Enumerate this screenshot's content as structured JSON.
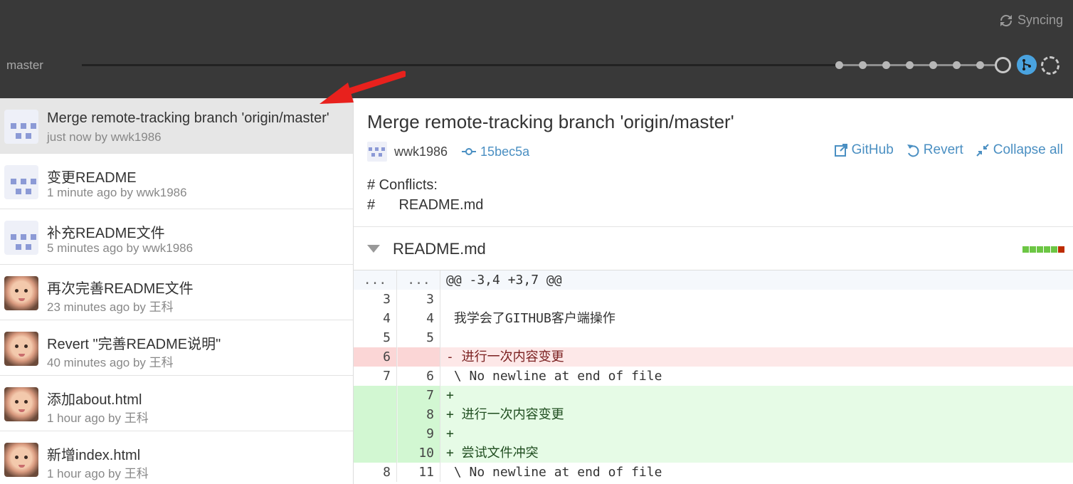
{
  "topbar": {
    "sync_label": "Syncing",
    "branch": "master"
  },
  "commits": [
    {
      "title": "Merge remote-tracking branch 'origin/master'",
      "meta": "just now by wwk1986",
      "avatar": "identicon"
    },
    {
      "title": "变更README",
      "meta": "1 minute ago by wwk1986",
      "avatar": "identicon"
    },
    {
      "title": "补充README文件",
      "meta": "5 minutes ago by wwk1986",
      "avatar": "identicon"
    },
    {
      "title": "再次完善README文件",
      "meta": "23 minutes ago by 王科",
      "avatar": "photo"
    },
    {
      "title": "Revert \"完善README说明\"",
      "meta": "40 minutes ago by 王科",
      "avatar": "photo"
    },
    {
      "title": "添加about.html",
      "meta": "1 hour ago by 王科",
      "avatar": "photo"
    },
    {
      "title": "新增index.html",
      "meta": "1 hour ago by 王科",
      "avatar": "photo"
    }
  ],
  "detail": {
    "title": "Merge remote-tracking branch 'origin/master'",
    "author": "wwk1986",
    "sha": "15bec5a",
    "actions": {
      "github": "GitHub",
      "revert": "Revert",
      "collapse": "Collapse all"
    },
    "body": "# Conflicts:\n#\tREADME.md",
    "file": {
      "name": "README.md",
      "stat_colors": [
        "#6cc644",
        "#6cc644",
        "#6cc644",
        "#6cc644",
        "#6cc644",
        "#bd2c00"
      ]
    },
    "diff": [
      {
        "type": "hunk",
        "old": "...",
        "new": "...",
        "text": "@@ -3,4 +3,7 @@"
      },
      {
        "type": "ctx",
        "old": "3",
        "new": "3",
        "text": " "
      },
      {
        "type": "ctx",
        "old": "4",
        "new": "4",
        "text": " 我学会了GITHUB客户端操作"
      },
      {
        "type": "ctx",
        "old": "5",
        "new": "5",
        "text": " "
      },
      {
        "type": "del",
        "old": "6",
        "new": "",
        "text": "- 进行一次内容变更"
      },
      {
        "type": "ctx",
        "old": "7",
        "new": "6",
        "text": " \\ No newline at end of file"
      },
      {
        "type": "add",
        "old": "",
        "new": "7",
        "text": "+"
      },
      {
        "type": "add",
        "old": "",
        "new": "8",
        "text": "+ 进行一次内容变更"
      },
      {
        "type": "add",
        "old": "",
        "new": "9",
        "text": "+"
      },
      {
        "type": "add",
        "old": "",
        "new": "10",
        "text": "+ 尝试文件冲突"
      },
      {
        "type": "ctx",
        "old": "8",
        "new": "11",
        "text": " \\ No newline at end of file"
      }
    ]
  }
}
